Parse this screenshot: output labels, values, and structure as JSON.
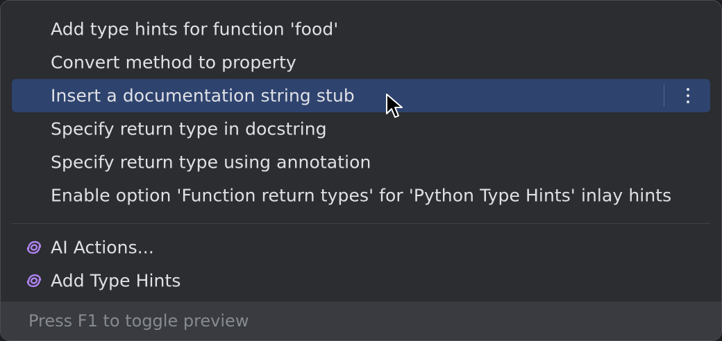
{
  "menu": {
    "items": [
      {
        "label": "Add type hints for function 'food'"
      },
      {
        "label": "Convert method to property"
      },
      {
        "label": "Insert a documentation string stub",
        "selected": true
      },
      {
        "label": "Specify return type in docstring"
      },
      {
        "label": "Specify return type using annotation"
      },
      {
        "label": "Enable option 'Function return types' for 'Python Type Hints' inlay hints"
      }
    ],
    "ai_items": [
      {
        "label": "AI Actions...",
        "icon": "ai-assistant-icon"
      },
      {
        "label": "Add Type Hints",
        "icon": "ai-assistant-icon"
      }
    ]
  },
  "footer": {
    "hint": "Press F1 to toggle preview"
  },
  "colors": {
    "background": "#2b2d30",
    "selection": "#2e436e",
    "text": "#dfe1e5",
    "footer_bg": "#393b40",
    "footer_text": "#868a91",
    "ai_icon": "#b083f0"
  }
}
